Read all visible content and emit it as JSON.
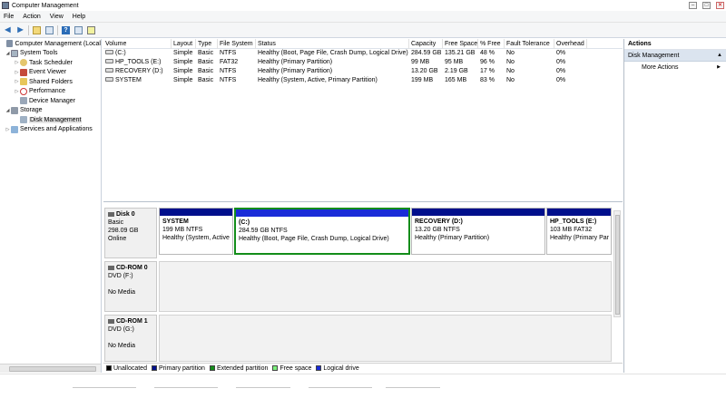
{
  "window": {
    "title": "Computer Management",
    "buttons": {
      "minimize": "–",
      "maximize": "□",
      "close": "✕"
    }
  },
  "menu": [
    "File",
    "Action",
    "View",
    "Help"
  ],
  "toolbar": {
    "icons": [
      "back-arrow-icon",
      "forward-arrow-icon",
      "up-folder-icon",
      "show-hide-tree-icon",
      "help-icon",
      "properties-icon",
      "console-icon"
    ]
  },
  "tree": {
    "items": [
      {
        "label": "Computer Management (Local",
        "level": 0,
        "expander": "",
        "icon": "computer-management-icon"
      },
      {
        "label": "System Tools",
        "level": 1,
        "expander": "◢",
        "icon": "system-tools-icon"
      },
      {
        "label": "Task Scheduler",
        "level": 2,
        "expander": "▷",
        "icon": "task-scheduler-icon"
      },
      {
        "label": "Event Viewer",
        "level": 2,
        "expander": "▷",
        "icon": "event-viewer-icon"
      },
      {
        "label": "Shared Folders",
        "level": 2,
        "expander": "▷",
        "icon": "shared-folders-icon"
      },
      {
        "label": "Performance",
        "level": 2,
        "expander": "▷",
        "icon": "performance-icon"
      },
      {
        "label": "Device Manager",
        "level": 2,
        "expander": "",
        "icon": "device-manager-icon"
      },
      {
        "label": "Storage",
        "level": 1,
        "expander": "◢",
        "icon": "storage-icon"
      },
      {
        "label": "Disk Management",
        "level": 2,
        "expander": "",
        "icon": "disk-management-icon",
        "selected": true
      },
      {
        "label": "Services and Applications",
        "level": 1,
        "expander": "▷",
        "icon": "services-applications-icon"
      }
    ]
  },
  "volumes": {
    "headers": [
      "Volume",
      "Layout",
      "Type",
      "File System",
      "Status",
      "Capacity",
      "Free Space",
      "% Free",
      "Fault Tolerance",
      "Overhead"
    ],
    "rows": [
      [
        "(C:)",
        "Simple",
        "Basic",
        "NTFS",
        "Healthy (Boot, Page File, Crash Dump, Logical Drive)",
        "284.59 GB",
        "135.21 GB",
        "48 %",
        "No",
        "0%"
      ],
      [
        "HP_TOOLS (E:)",
        "Simple",
        "Basic",
        "FAT32",
        "Healthy (Primary Partition)",
        "99 MB",
        "95 MB",
        "96 %",
        "No",
        "0%"
      ],
      [
        "RECOVERY (D:)",
        "Simple",
        "Basic",
        "NTFS",
        "Healthy (Primary Partition)",
        "13.20 GB",
        "2.19 GB",
        "17 %",
        "No",
        "0%"
      ],
      [
        "SYSTEM",
        "Simple",
        "Basic",
        "NTFS",
        "Healthy (System, Active, Primary Partition)",
        "199 MB",
        "165 MB",
        "83 %",
        "No",
        "0%"
      ]
    ]
  },
  "disks": [
    {
      "name": "Disk 0",
      "lines": [
        "Basic",
        "298.09 GB",
        "Online"
      ],
      "partitions": [
        {
          "name": "SYSTEM",
          "size": "199 MB NTFS",
          "status": "Healthy (System, Active"
        },
        {
          "name": "(C:)",
          "size": "284.59 GB NTFS",
          "status": "Healthy (Boot, Page File, Crash Dump, Logical Drive)"
        },
        {
          "name": "RECOVERY  (D:)",
          "size": "13.20 GB NTFS",
          "status": "Healthy (Primary Partition)"
        },
        {
          "name": "HP_TOOLS  (E:)",
          "size": "103 MB FAT32",
          "status": "Healthy (Primary Par"
        }
      ]
    },
    {
      "name": "CD-ROM 0",
      "lines": [
        "DVD (F:)",
        "",
        "No Media"
      ]
    },
    {
      "name": "CD-ROM 1",
      "lines": [
        "DVD (G:)",
        "",
        "No Media"
      ]
    }
  ],
  "legend": [
    {
      "label": "Unallocated",
      "color": "#000000"
    },
    {
      "label": "Primary partition",
      "color": "#000f8c"
    },
    {
      "label": "Extended partition",
      "color": "#138d1a"
    },
    {
      "label": "Free space",
      "color": "#7cf07c"
    },
    {
      "label": "Logical drive",
      "color": "#1a2cd8"
    }
  ],
  "actions": {
    "header": "Actions",
    "section": "Disk Management",
    "section_chevron": "▲",
    "items": [
      {
        "label": "More Actions",
        "arrow": "▶"
      }
    ]
  }
}
